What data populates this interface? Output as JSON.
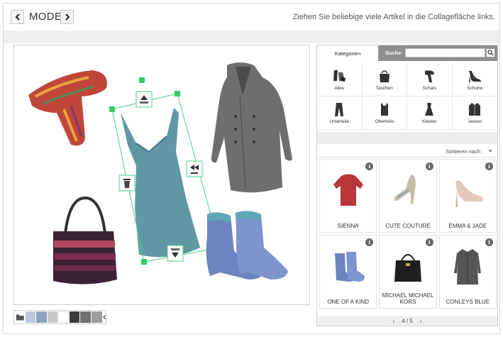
{
  "header": {
    "mode_label": "MODE",
    "hint": "Ziehen Sie beliebige viele Artikel in die Collagefläche links.",
    "prev_icon": "chevron-left-icon",
    "next_icon": "chevron-right-icon"
  },
  "canvas": {
    "items": [
      "scarf",
      "coat",
      "handbag",
      "dress",
      "boots"
    ],
    "selected_item": "dress",
    "handle_icons": [
      "layer-up-icon",
      "flip-icon",
      "trash-icon",
      "layer-down-icon"
    ],
    "frame_color": "#4ccf8a"
  },
  "swatches": {
    "icon": "folder-icon",
    "colors": [
      "#b7c9de",
      "#8da3bd",
      "#c7c7c7",
      "#ffffff",
      "#3b3b3b",
      "#707070",
      "#9c9c9c"
    ]
  },
  "panel": {
    "tab_categories": "Kategorien",
    "tab_search": "Suche",
    "search_value": "",
    "categories": [
      {
        "label": "Alles",
        "icon": "all-icon"
      },
      {
        "label": "Taschen",
        "icon": "bag-icon"
      },
      {
        "label": "Schals",
        "icon": "scarf-icon"
      },
      {
        "label": "Schuhe",
        "icon": "shoe-icon"
      },
      {
        "label": "Unterteile",
        "icon": "pants-icon"
      },
      {
        "label": "Oberteile",
        "icon": "top-icon"
      },
      {
        "label": "Kleider",
        "icon": "dress-icon"
      },
      {
        "label": "Jacken",
        "icon": "jacket-icon"
      }
    ],
    "sort_label": "Sortieren nach",
    "products": [
      {
        "name": "SIENNA",
        "icon": "sweater-icon"
      },
      {
        "name": "CUTE COUTURE",
        "icon": "sandal-icon"
      },
      {
        "name": "EMMA & JADE",
        "icon": "pump-icon"
      },
      {
        "name": "ONE OF A KIND",
        "icon": "boots-icon"
      },
      {
        "name": "MICHAEL MICHAEL KORS",
        "icon": "handbag-icon"
      },
      {
        "name": "CONLEYS BLUE",
        "icon": "coat-icon"
      }
    ],
    "info_label": "i",
    "pager": {
      "text": "4 / 5",
      "prev": "‹",
      "next": "›"
    }
  }
}
